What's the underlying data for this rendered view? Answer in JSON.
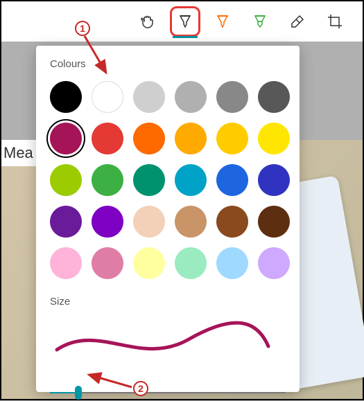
{
  "toolbar": {
    "tools": [
      {
        "name": "touch-writing",
        "selected": false
      },
      {
        "name": "ballpoint-pen",
        "selected": true
      },
      {
        "name": "pencil",
        "selected": false
      },
      {
        "name": "highlighter",
        "selected": false
      },
      {
        "name": "eraser",
        "selected": false
      },
      {
        "name": "crop",
        "selected": false
      }
    ]
  },
  "panel": {
    "colours_label": "Colours",
    "size_label": "Size",
    "colours": [
      "#000000",
      "#ffffff",
      "#cfcfcf",
      "#b0b0b0",
      "#888888",
      "#585858",
      "#a61458",
      "#e53935",
      "#ff6a00",
      "#ffaa00",
      "#ffcc00",
      "#ffe600",
      "#9ccc00",
      "#3cb043",
      "#00926f",
      "#00a3c7",
      "#1e65e0",
      "#3033c0",
      "#6a1b9a",
      "#7e00c2",
      "#f3d0b8",
      "#c99468",
      "#8a4a1d",
      "#5e2e10",
      "#ffb3d9",
      "#e07da6",
      "#ffffa0",
      "#9bebc0",
      "#9fd9ff",
      "#cfa8ff"
    ],
    "selected_colour_index": 6,
    "size_value": 12,
    "preview_colour": "#a61458",
    "slider_accent": "#0097a7"
  },
  "background": {
    "cropped_text": "Mea"
  },
  "callouts": {
    "c1": "1",
    "c2": "2"
  }
}
